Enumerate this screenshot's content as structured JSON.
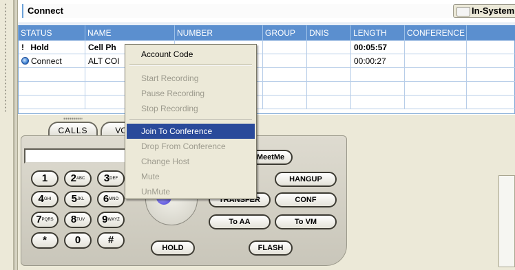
{
  "connect_bar": {
    "title": "Connect",
    "in_system_label": "In-System"
  },
  "grid": {
    "columns": [
      "STATUS",
      "NAME",
      "NUMBER",
      "GROUP",
      "DNIS",
      "LENGTH",
      "CONFERENCE"
    ],
    "rows": [
      {
        "status": "Hold",
        "name": "Cell Ph",
        "number": "",
        "group": "",
        "dnis": "",
        "length": "00:05:57",
        "conference": ""
      },
      {
        "status": "Connect",
        "name": "ALT COI",
        "number": "",
        "group": "",
        "dnis": "",
        "length": "00:00:27",
        "conference": ""
      }
    ]
  },
  "tabs": {
    "calls": "CALLS",
    "vo": "VO"
  },
  "keypad": {
    "keys": [
      {
        "digit": "1",
        "letters": ""
      },
      {
        "digit": "2",
        "letters": "ABC"
      },
      {
        "digit": "3",
        "letters": "DEF"
      },
      {
        "digit": "4",
        "letters": "GHI"
      },
      {
        "digit": "5",
        "letters": "JKL"
      },
      {
        "digit": "6",
        "letters": "MNO"
      },
      {
        "digit": "7",
        "letters": "PQRS"
      },
      {
        "digit": "8",
        "letters": "TUV"
      },
      {
        "digit": "9",
        "letters": "WXYZ"
      },
      {
        "digit": "*",
        "letters": ""
      },
      {
        "digit": "0",
        "letters": ""
      },
      {
        "digit": "#",
        "letters": ""
      }
    ],
    "dial_value": ""
  },
  "buttons": {
    "meetme": "MeetMe",
    "hangup": "HANGUP",
    "transfer": "TRANSFER",
    "conf": "CONF",
    "to_aa": "To AA",
    "to_vm": "To VM",
    "hold": "HOLD",
    "flash": "FLASH"
  },
  "context_menu": {
    "items": [
      {
        "label": "Account Code",
        "enabled": true
      },
      {
        "label": "Start Recording",
        "enabled": false
      },
      {
        "label": "Pause Recording",
        "enabled": false
      },
      {
        "label": "Stop Recording",
        "enabled": false
      },
      {
        "label": "Join To Conference",
        "enabled": true,
        "selected": true
      },
      {
        "label": "Drop From Conference",
        "enabled": false
      },
      {
        "label": "Change Host",
        "enabled": false
      },
      {
        "label": "Mute",
        "enabled": false
      },
      {
        "label": "UnMute",
        "enabled": false
      }
    ]
  },
  "colors": {
    "header": "#5b8fcf",
    "selection": "#2a4a9a"
  }
}
